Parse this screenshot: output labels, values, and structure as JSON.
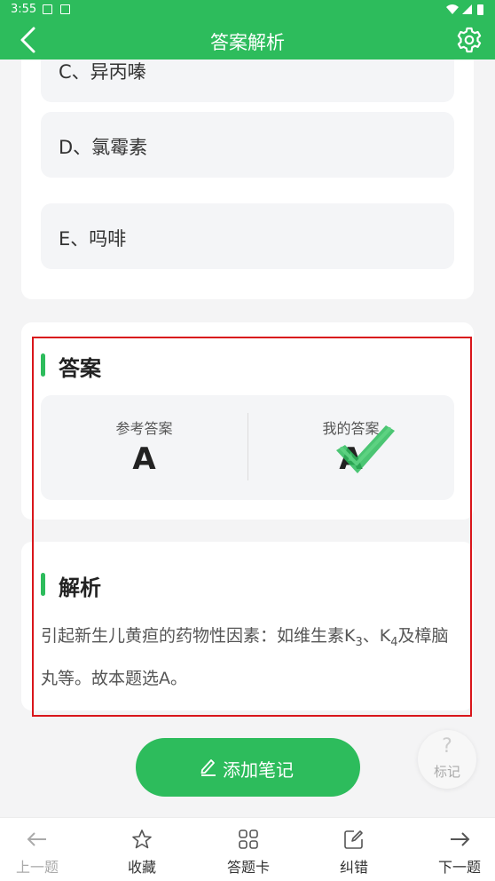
{
  "status_bar": {
    "time": "3:55"
  },
  "header": {
    "title": "答案解析"
  },
  "options": [
    {
      "label": "C、异丙嗪"
    },
    {
      "label": "D、氯霉素"
    },
    {
      "label": "E、吗啡"
    }
  ],
  "answer": {
    "title": "答案",
    "reference_label": "参考答案",
    "reference_value": "A",
    "my_label": "我的答案",
    "my_value": "A",
    "correct_color": "#2dbc5c"
  },
  "explanation": {
    "title": "解析",
    "text_part1": "引起新生儿黄疸的药物性因素：如维生素K",
    "sub1": "3",
    "sep": "、K",
    "sub2": "4",
    "text_part2": "及樟脑丸等。故本题选A。"
  },
  "actions": {
    "add_note": "添加笔记",
    "mark": "标记",
    "mark_icon": "?"
  },
  "bottom_nav": [
    {
      "label": "上一题",
      "icon": "arrow-left-icon"
    },
    {
      "label": "收藏",
      "icon": "star-icon"
    },
    {
      "label": "答题卡",
      "icon": "grid-icon"
    },
    {
      "label": "纠错",
      "icon": "edit-icon"
    },
    {
      "label": "下一题",
      "icon": "arrow-right-icon"
    }
  ],
  "colors": {
    "brand": "#2dbc5c",
    "highlight_border": "#d9161b"
  }
}
